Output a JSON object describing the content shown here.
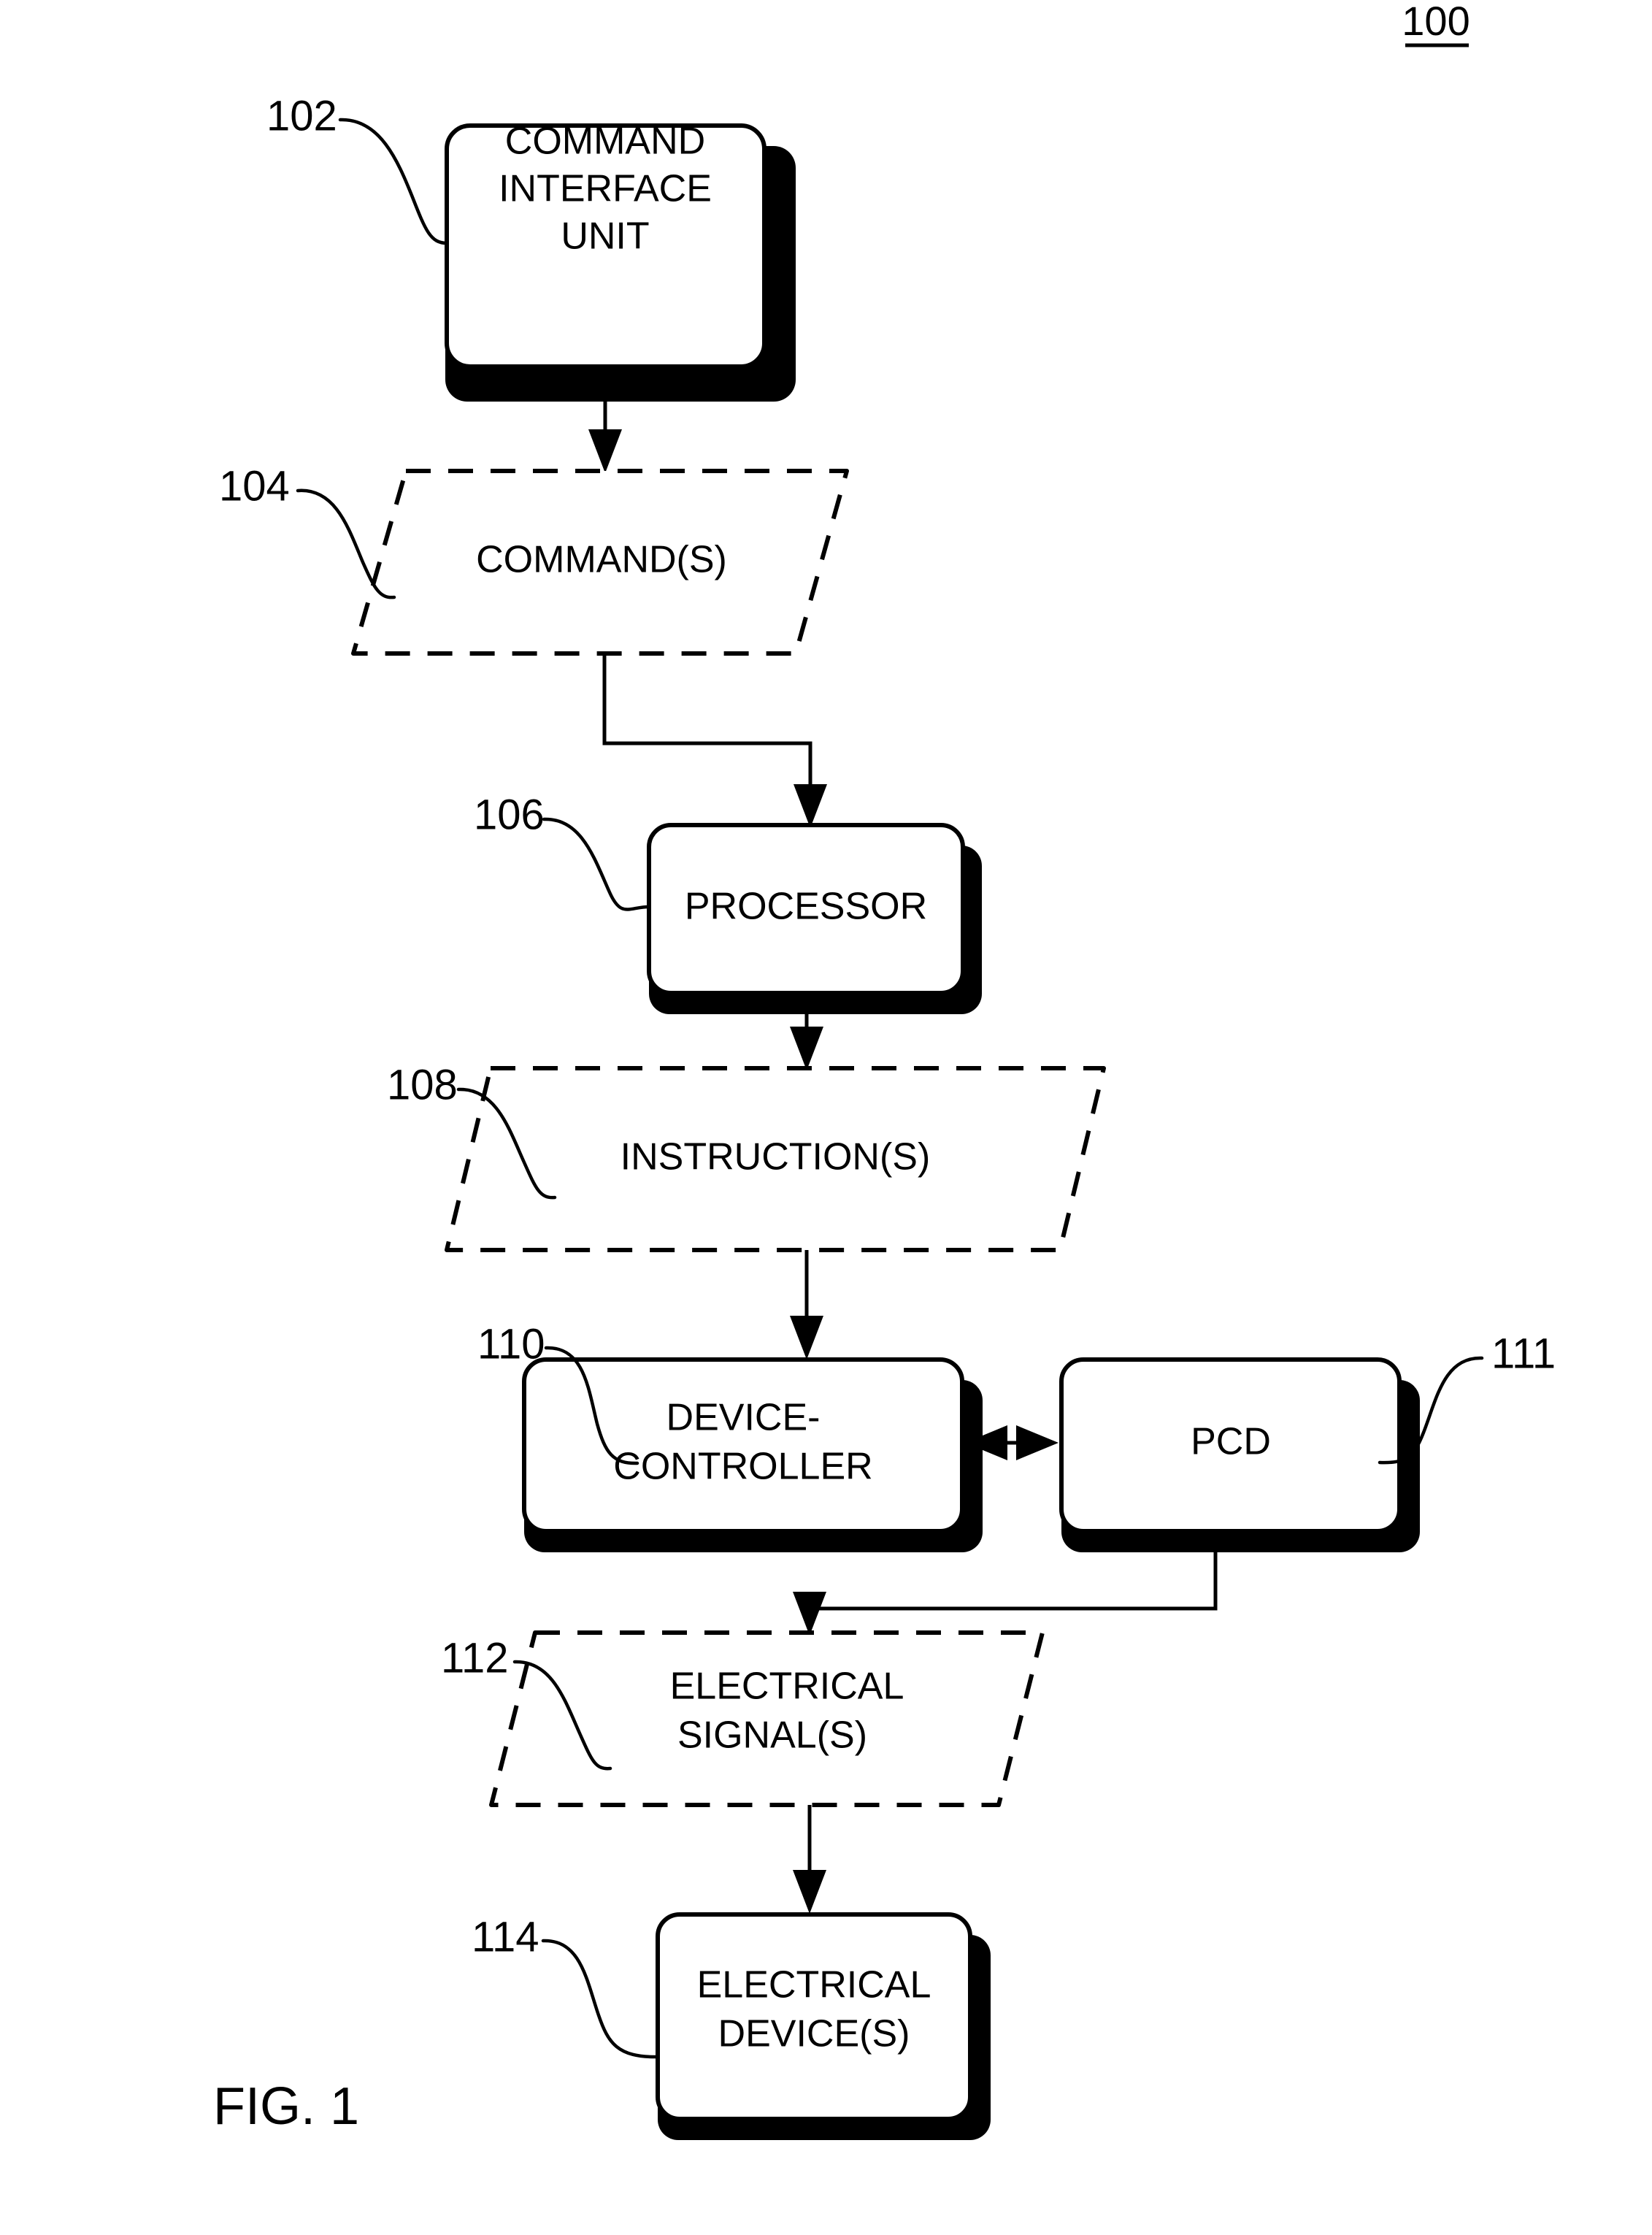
{
  "figure": {
    "caption": "FIG. 1",
    "system_number": "100"
  },
  "nodes": {
    "command_interface_unit": {
      "ref": "102",
      "label_line1": "COMMAND",
      "label_line2": "INTERFACE",
      "label_line3": "UNIT",
      "shape": "rounded-rect-shadow"
    },
    "commands": {
      "ref": "104",
      "label": "COMMAND(S)",
      "shape": "dashed-parallelogram"
    },
    "processor": {
      "ref": "106",
      "label": "PROCESSOR",
      "shape": "rounded-rect-shadow"
    },
    "instructions": {
      "ref": "108",
      "label": "INSTRUCTION(S)",
      "shape": "dashed-parallelogram"
    },
    "device_controller": {
      "ref": "110",
      "label_line1": "DEVICE-",
      "label_line2": "CONTROLLER",
      "shape": "rounded-rect-shadow"
    },
    "pcd": {
      "ref": "111",
      "label": "PCD",
      "shape": "rounded-rect-shadow"
    },
    "electrical_signals": {
      "ref": "112",
      "label_line1": "ELECTRICAL",
      "label_line2": "SIGNAL(S)",
      "shape": "dashed-parallelogram"
    },
    "electrical_devices": {
      "ref": "114",
      "label_line1": "ELECTRICAL",
      "label_line2": "DEVICE(S)",
      "shape": "rounded-rect-shadow"
    }
  },
  "colors": {
    "line": "#000000",
    "fill": "#ffffff"
  }
}
